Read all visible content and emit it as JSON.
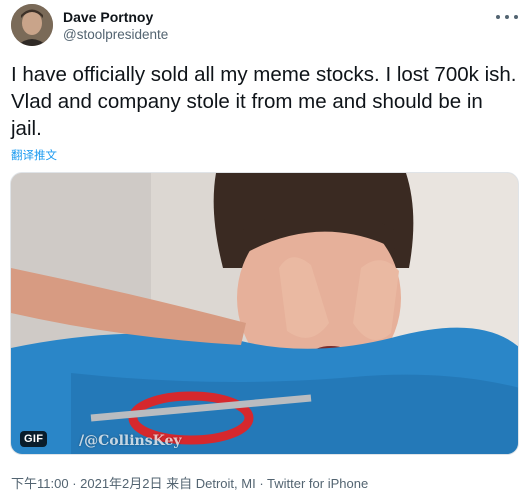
{
  "author": {
    "name": "Dave Portnoy",
    "handle": "@stoolpresidente"
  },
  "tweet": {
    "lines": [
      "I have officially sold all my meme stocks.  I lost 700k ish.",
      "Vlad and company stole it from me and should be in",
      "jail."
    ],
    "translate_label": "翻译推文"
  },
  "media": {
    "badge": "GIF",
    "watermark": "/@CollinsKey"
  },
  "meta": {
    "time": "下午11:00",
    "separator": " · ",
    "date_source": "2021年2月2日 来自 Detroit, MI",
    "client": "Twitter for iPhone"
  },
  "icons": {
    "more": "more-dots-icon"
  },
  "colors": {
    "text": "#0f1419",
    "secondary": "#536471",
    "link": "#1d9bf0",
    "shirt": "#2a86c8"
  }
}
